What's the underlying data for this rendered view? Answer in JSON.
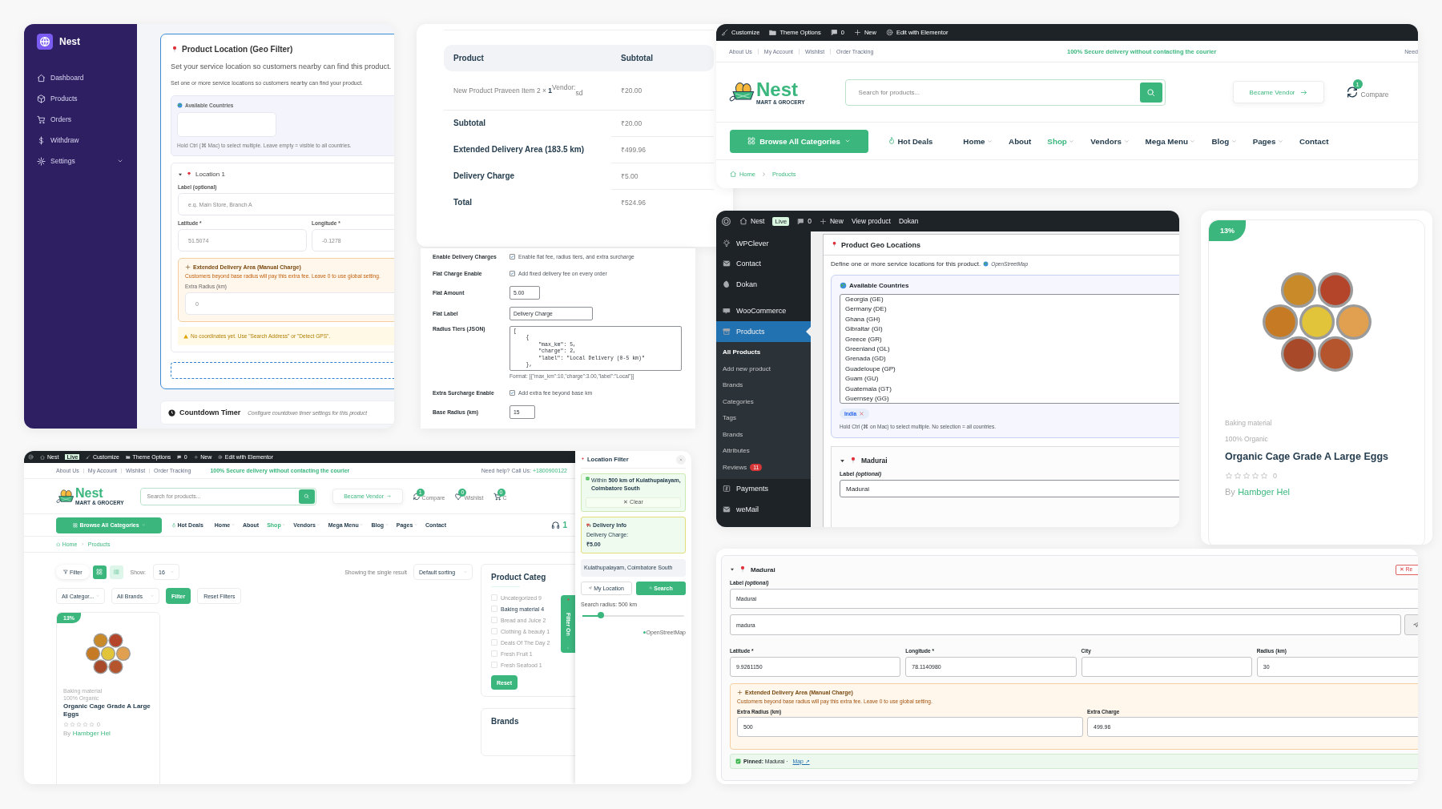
{
  "vendor_dashboard": {
    "brand": "Nest",
    "sidebar_items": [
      {
        "label": "Dashboard",
        "has_submenu": false
      },
      {
        "label": "Products",
        "has_submenu": false
      },
      {
        "label": "Orders",
        "has_submenu": false
      },
      {
        "label": "Withdraw",
        "has_submenu": false
      },
      {
        "label": "Settings",
        "has_submenu": true
      }
    ],
    "geo_filter": {
      "title": "Product Location (Geo Filter)",
      "description": "Set your service location so customers nearby can find this product.",
      "hint": "Set one or more service locations so customers nearby can find your product.",
      "countries": {
        "label": "Available Countries",
        "help": "Hold Ctrl (⌘ Mac) to select multiple. Leave empty = visible to all countries."
      },
      "location": {
        "title": "Location 1",
        "expanded": true,
        "label_field": {
          "label": "Label (optional)",
          "placeholder": "e.g. Main Store, Branch A"
        },
        "latitude": {
          "label": "Latitude *",
          "placeholder": "51.5074"
        },
        "longitude": {
          "label": "Longitude *",
          "placeholder": "-0.1278"
        },
        "extended": {
          "title": "Extended Delivery Area (Manual Charge)",
          "note": "Customers beyond base radius will pay this extra fee. Leave 0 to use global setting.",
          "field": {
            "label": "Extra Radius (km)",
            "placeholder": "0"
          }
        },
        "warning": "No coordinates yet. Use \"Search Address\" or \"Detect GPS\"."
      }
    },
    "countdown": {
      "title": "Countdown Timer",
      "subtitle": "Configure countdown timer settings for this product"
    }
  },
  "order_summary": {
    "columns": [
      "Product",
      "Subtotal"
    ],
    "item": {
      "name": "New Product Praveen Item 2 × **1**$^{Vendor:}$$_{sd}$",
      "subtotal": "₹20.00"
    },
    "totals": [
      {
        "label": "Subtotal",
        "value": "₹20.00"
      },
      {
        "label": "Extended Delivery Area (183.5 km)",
        "value": "₹499.96"
      },
      {
        "label": "Delivery Charge",
        "value": "₹5.00"
      },
      {
        "label": "Total",
        "value": "₹524.96"
      }
    ]
  },
  "delivery_settings": {
    "rows": [
      {
        "kind": "checkbox",
        "label": "Enable Delivery Charges",
        "checked": true,
        "text": "Enable flat fee, radius tiers, and extra surcharge"
      },
      {
        "kind": "checkbox",
        "label": "Flat Charge Enable",
        "checked": true,
        "text": "Add fixed delivery fee on every order"
      },
      {
        "kind": "input",
        "label": "Flat Amount",
        "value": "5.00"
      },
      {
        "kind": "input",
        "label": "Flat Label",
        "value": "Delivery Charge"
      },
      {
        "kind": "textarea",
        "label": "Radius Tiers (JSON)",
        "value": "[\n    {\n        \"max_km\": 5,\n        \"charge\": 2,\n        \"label\": \"Local Delivery (0-5 km)\"\n    },",
        "hint": "Format: [{\"max_km\":10,\"charge\":3.00,\"label\":\"Local\"}]"
      },
      {
        "kind": "checkbox",
        "label": "Extra Surcharge Enable",
        "checked": true,
        "text": "Add extra fee beyond base km"
      },
      {
        "kind": "input",
        "label": "Base Radius (km)",
        "value": "15"
      }
    ]
  },
  "storefront_header": {
    "admin_bar": [
      "Customize",
      "Theme Options",
      "0",
      "New",
      "Edit with Elementor"
    ],
    "top_links": [
      "About Us",
      "My Account",
      "Wishlist",
      "Order Tracking"
    ],
    "promo": "100% Secure delivery without contacting the courier",
    "help": "Need",
    "logo": {
      "name": "Nest",
      "tagline": "MART & GROCERY"
    },
    "search": {
      "placeholder": "Search for products..."
    },
    "vendor_button": "Became Vendor",
    "header_actions": [
      {
        "label": "Compare",
        "count": "1"
      }
    ],
    "nav": {
      "categories_button": "Browse All Categories",
      "hot_deals": "Hot Deals",
      "items": [
        {
          "label": "Home",
          "selected": false,
          "has_dropdown": true
        },
        {
          "label": "About",
          "selected": false,
          "has_dropdown": false
        },
        {
          "label": "Shop",
          "selected": true,
          "has_dropdown": true
        },
        {
          "label": "Vendors",
          "selected": false,
          "has_dropdown": true
        },
        {
          "label": "Mega Menu",
          "selected": false,
          "has_dropdown": true
        },
        {
          "label": "Blog",
          "selected": false,
          "has_dropdown": true
        },
        {
          "label": "Pages",
          "selected": false,
          "has_dropdown": true
        },
        {
          "label": "Contact",
          "selected": false,
          "has_dropdown": false
        }
      ]
    },
    "breadcrumb": [
      "Home",
      "Products"
    ]
  },
  "wp_admin": {
    "admin_bar": {
      "site": "Nest",
      "live": "Live",
      "items": [
        "0",
        "New",
        "View product",
        "Dokan"
      ]
    },
    "menu": [
      {
        "label": "WPClever",
        "selected": false
      },
      {
        "label": "Contact",
        "selected": false
      },
      {
        "label": "Dokan",
        "selected": false
      },
      {
        "label": "WooCommerce",
        "selected": false
      },
      {
        "label": "Products",
        "selected": true,
        "submenu": [
          {
            "label": "All Products",
            "selected": true
          },
          {
            "label": "Add new product",
            "selected": false
          },
          {
            "label": "Brands",
            "selected": false
          },
          {
            "label": "Categories",
            "selected": false
          },
          {
            "label": "Tags",
            "selected": false
          },
          {
            "label": "Brands",
            "selected": false
          },
          {
            "label": "Attributes",
            "selected": false
          },
          {
            "label": "Reviews",
            "selected": false,
            "badge": "11"
          }
        ]
      },
      {
        "label": "Payments",
        "selected": false
      },
      {
        "label": "weMail",
        "selected": false
      }
    ],
    "meta_box": {
      "title": "Product Geo Locations",
      "description": "Define one or more service locations for this product.",
      "map_credit": "OpenStreetMap",
      "countries": {
        "label": "Available Countries",
        "options": [
          "Georgia (GE)",
          "Germany (DE)",
          "Ghana (GH)",
          "Gibraltar (GI)",
          "Greece (GR)",
          "Greenland (GL)",
          "Grenada (GD)",
          "Guadeloupe (GP)",
          "Guam (GU)",
          "Guatemala (GT)",
          "Guernsey (GG)"
        ],
        "chips": [
          "India"
        ],
        "help": "Hold Ctrl (⌘ on Mac) to select multiple. No selection = all countries."
      },
      "location": {
        "title": "Madurai",
        "expanded": true,
        "label_field": {
          "label": "Label *(optional)*",
          "value": "Madurai"
        }
      }
    }
  },
  "product_card": {
    "badge": "13%",
    "category": "Baking material",
    "tag": "100% Organic",
    "title": "Organic Cage Grade A Large Eggs",
    "stars": 0,
    "reviews": "0",
    "by": "By",
    "vendor": "Hambger Hel"
  },
  "shop_page": {
    "admin_bar": {
      "site": "Nest",
      "live": "Live",
      "items": [
        "Customize",
        "Theme Options",
        "0",
        "New",
        "Edit with Elementor"
      ]
    },
    "top_links": [
      "About Us",
      "My Account",
      "Wishlist",
      "Order Tracking"
    ],
    "promo": "100% Secure delivery without contacting the courier",
    "help": "Need help? Call Us:",
    "phone": "+1800900122",
    "logo": {
      "name": "Nest",
      "tagline": "MART & GROCERY"
    },
    "search": {
      "placeholder": "Search for products..."
    },
    "vendor_button": "Became Vendor",
    "header_actions": [
      {
        "label": "Compare",
        "count": "1"
      },
      {
        "label": "Wishlist",
        "count": "0"
      },
      {
        "label": "C",
        "count": "0"
      }
    ],
    "nav": {
      "categories_button": "Browse All Categories",
      "hot_deals": "Hot Deals",
      "items": [
        {
          "label": "Home",
          "selected": false,
          "has_dropdown": true
        },
        {
          "label": "About",
          "selected": false,
          "has_dropdown": false
        },
        {
          "label": "Shop",
          "selected": true,
          "has_dropdown": true
        },
        {
          "label": "Vendors",
          "selected": false,
          "has_dropdown": true
        },
        {
          "label": "Mega Menu",
          "selected": false,
          "has_dropdown": true
        },
        {
          "label": "Blog",
          "selected": false,
          "has_dropdown": true
        },
        {
          "label": "Pages",
          "selected": false,
          "has_dropdown": true
        },
        {
          "label": "Contact",
          "selected": false,
          "has_dropdown": false
        }
      ]
    },
    "support": {
      "number": "1"
    },
    "breadcrumb": [
      "Home",
      "Products"
    ],
    "toolbar": {
      "filter": "Filter",
      "views": [
        {
          "selected": true
        },
        {
          "selected": false
        }
      ],
      "show_label": "Show:",
      "show_value": "16",
      "result": "Showing the single result",
      "sorting": "Default sorting"
    },
    "filters": {
      "category": "All Categor...",
      "brand": "All Brands",
      "apply": "Filter",
      "reset": "Reset Filters"
    },
    "products": [
      {
        "badge": "13%",
        "category": "Baking material",
        "tag": "100% Organic",
        "title": "Organic Cage Grade A Large Eggs",
        "stars": 0,
        "reviews": "0",
        "by": "By",
        "vendor": "Hambger Hel"
      }
    ],
    "categories_widget": {
      "title": "Product Categ",
      "items": [
        {
          "label": "Uncategorized 9",
          "checked": false,
          "disabled": true
        },
        {
          "label": "Baking material 4",
          "checked": false,
          "disabled": false
        },
        {
          "label": "Bread and Juice 2",
          "checked": false,
          "disabled": true
        },
        {
          "label": "Clothing & beauty 1",
          "checked": false,
          "disabled": true
        },
        {
          "label": "Deals Of The Day 2",
          "checked": false,
          "disabled": true
        },
        {
          "label": "Fresh Fruit 1",
          "checked": false,
          "disabled": true
        },
        {
          "label": "Fresh Seafood 1",
          "checked": false,
          "disabled": true
        }
      ],
      "reset": "Reset"
    },
    "brands_widget": {
      "title": "Brands"
    },
    "filter_tab": {
      "label": "Filter On"
    },
    "location_drawer": {
      "title": "Location Filter",
      "active_filter": {
        "text": "Within **500 km of Kulathupalayam, Coimbatore South**",
        "clear": "✕ Clear"
      },
      "delivery": {
        "title": "Delivery Info",
        "label": "Delivery Charge:",
        "value": "₹5.00"
      },
      "address": {
        "value": "Kulathupalayam, Coimbatore South"
      },
      "buttons": [
        {
          "label": "My Location",
          "kind": "secondary"
        },
        {
          "label": "Search",
          "kind": "primary"
        }
      ],
      "radius": {
        "label": "Search radius: 500 km",
        "level": 0.18
      },
      "credit": "OpenStreetMap"
    }
  },
  "location_editor": {
    "title": "Madurai",
    "expanded": true,
    "remove": "✕ Re",
    "label_field": {
      "label": "Label *(optional)*",
      "value": "Madurai"
    },
    "search": {
      "value": "madura"
    },
    "fields": [
      {
        "label": "Latitude *",
        "value": "9.9261150"
      },
      {
        "label": "Longitude *",
        "value": "78.1140980"
      },
      {
        "label": "City"
      },
      {
        "label": "Radius (km)",
        "value": "30"
      }
    ],
    "extended": {
      "title": "Extended Delivery Area (Manual Charge)",
      "note": "Customers beyond base radius will pay this extra fee. Leave 0 to use global setting.",
      "fields": [
        {
          "label": "Extra Radius (km)",
          "value": "500"
        },
        {
          "label": "Extra Charge",
          "value": "499.96"
        }
      ]
    },
    "pinned": {
      "text": "**Pinned:** Madurai ·",
      "link": "Map ↗"
    }
  }
}
